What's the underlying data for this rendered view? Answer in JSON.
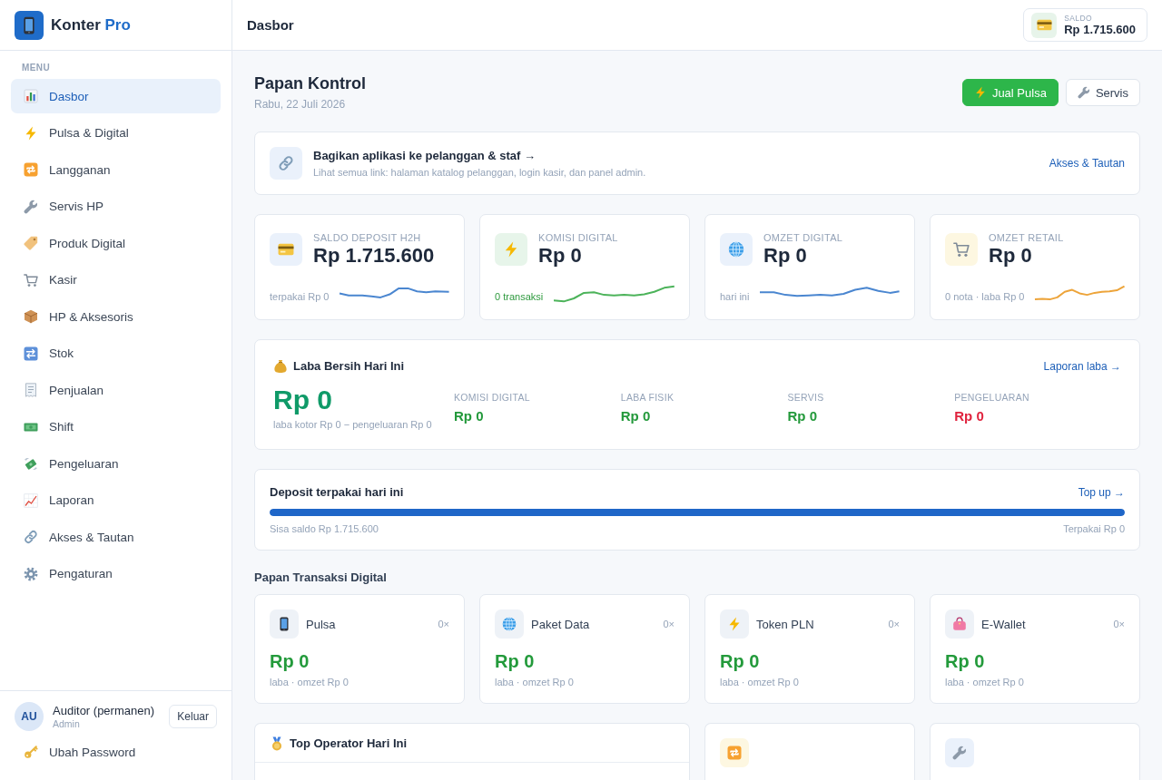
{
  "sidebar": {
    "brand": {
      "name": "Konter",
      "suffix": "Pro"
    },
    "section_label": "MENU",
    "items": [
      {
        "label": "Dasbor",
        "selected": true
      },
      {
        "label": "Pulsa & Digital",
        "selected": false
      },
      {
        "label": "Langganan",
        "selected": false
      },
      {
        "label": "Servis HP",
        "selected": false
      },
      {
        "label": "Produk Digital",
        "selected": false
      },
      {
        "label": "Kasir",
        "selected": false
      },
      {
        "label": "HP & Aksesoris",
        "selected": false
      },
      {
        "label": "Stok",
        "selected": false
      },
      {
        "label": "Penjualan",
        "selected": false
      },
      {
        "label": "Shift",
        "selected": false
      },
      {
        "label": "Pengeluaran",
        "selected": false
      },
      {
        "label": "Laporan",
        "selected": false
      },
      {
        "label": "Akses & Tautan",
        "selected": false
      },
      {
        "label": "Pengaturan",
        "selected": false
      }
    ],
    "user": {
      "initials": "AU",
      "name": "Auditor (permanen)",
      "role": "Admin",
      "logout_button": "Keluar"
    },
    "change_password": "Ubah Password"
  },
  "header": {
    "title": "Dasbor",
    "balance": {
      "label": "SALDO",
      "value": "Rp 1.715.600"
    }
  },
  "page": {
    "title": "Papan Kontrol",
    "date": "Rabu, 22 Juli 2026",
    "actions": [
      {
        "label": "Jual Pulsa",
        "kind": "primary"
      },
      {
        "label": "Servis",
        "kind": "secondary"
      }
    ]
  },
  "share_banner": {
    "title": "Bagikan aplikasi ke pelanggan & staf →",
    "description": "Lihat semua link: halaman katalog pelanggan, login kasir, dan panel admin.",
    "link": "Akses & Tautan"
  },
  "stat_cards": [
    {
      "label": "SALDO DEPOSIT H2H",
      "value": "Rp 1.715.600",
      "footer": "terpakai Rp 0",
      "footer_highlight": false,
      "color": "#4a86d0"
    },
    {
      "label": "KOMISI DIGITAL",
      "value": "Rp 0",
      "footer": "0 transaksi",
      "footer_highlight": true,
      "color": "#4cb35a"
    },
    {
      "label": "OMZET DIGITAL",
      "value": "Rp 0",
      "footer": "hari ini",
      "footer_highlight": false,
      "color": "#4a86d0"
    },
    {
      "label": "OMZET RETAIL",
      "value": "Rp 0",
      "footer": "0 nota · laba Rp 0",
      "footer_highlight": false,
      "color": "#eda43a"
    }
  ],
  "net_profit": {
    "title": "Laba Bersih Hari Ini",
    "link": "Laporan laba →",
    "value": "Rp 0",
    "formula": "laba kotor Rp 0 − pengeluaran Rp 0",
    "metrics": [
      {
        "label": "KOMISI DIGITAL",
        "value": "Rp 0",
        "color": "#23993b"
      },
      {
        "label": "LABA FISIK",
        "value": "Rp 0",
        "color": "#23993b"
      },
      {
        "label": "SERVIS",
        "value": "Rp 0",
        "color": "#23993b"
      },
      {
        "label": "PENGELUARAN",
        "value": "Rp 0",
        "color": "#e0243f"
      }
    ]
  },
  "deposit_usage": {
    "title": "Deposit terpakai hari ini",
    "link": "Top up →",
    "level": 1,
    "remaining": "Sisa saldo Rp 1.715.600",
    "used": "Terpakai Rp 0"
  },
  "digital_transactions": {
    "title": "Papan Transaksi Digital",
    "items": [
      {
        "name": "Pulsa",
        "count": "0×",
        "value": "Rp 0",
        "caption": "laba · omzet Rp 0"
      },
      {
        "name": "Paket Data",
        "count": "0×",
        "value": "Rp 0",
        "caption": "laba · omzet Rp 0"
      },
      {
        "name": "Token PLN",
        "count": "0×",
        "value": "Rp 0",
        "caption": "laba · omzet Rp 0"
      },
      {
        "name": "E-Wallet",
        "count": "0×",
        "value": "Rp 0",
        "caption": "laba · omzet Rp 0"
      }
    ]
  },
  "bottom_row": [
    {
      "kind": "list",
      "title": "Top Operator Hari Ini"
    },
    {
      "kind": "tile"
    },
    {
      "kind": "tile"
    }
  ]
}
